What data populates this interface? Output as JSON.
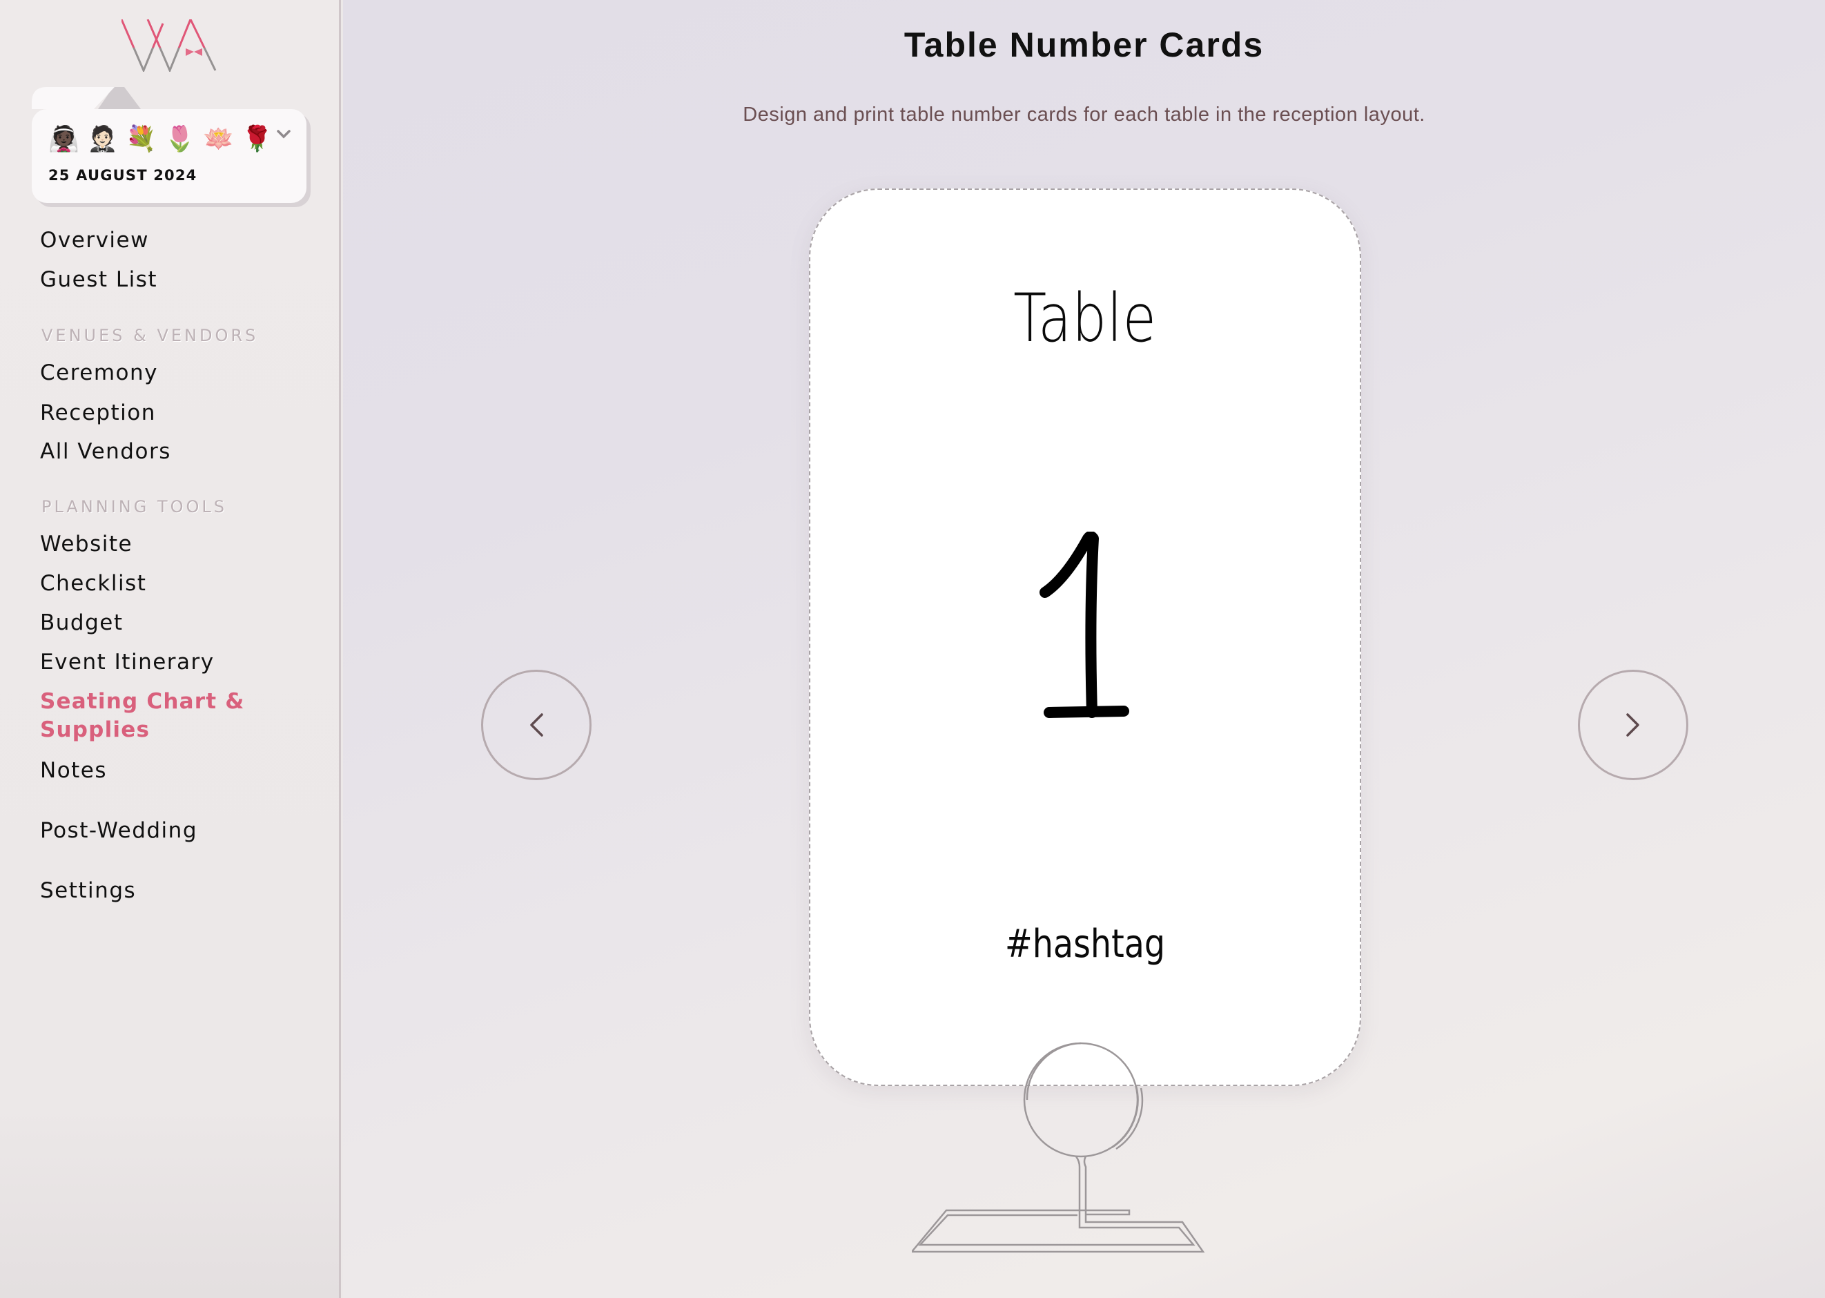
{
  "app": {
    "logo_text": "WA",
    "brand_color": "#d9607c"
  },
  "wedding_card": {
    "emojis": [
      {
        "name": "bride-icon",
        "glyph": "👰🏿"
      },
      {
        "name": "groom-icon",
        "glyph": "🤵🏻"
      },
      {
        "name": "bouquet-icon",
        "glyph": "💐"
      },
      {
        "name": "tulip-icon",
        "glyph": "🌷"
      },
      {
        "name": "lotus-icon",
        "glyph": "🪷"
      },
      {
        "name": "rose-icon",
        "glyph": "🌹"
      }
    ],
    "date": "25 AUGUST 2024"
  },
  "sidebar": {
    "items": [
      {
        "label": "Overview"
      },
      {
        "label": "Guest List"
      }
    ],
    "sections": [
      {
        "heading": "VENUES & VENDORS",
        "items": [
          {
            "label": "Ceremony"
          },
          {
            "label": "Reception"
          },
          {
            "label": "All Vendors"
          }
        ]
      },
      {
        "heading": "PLANNING TOOLS",
        "items": [
          {
            "label": "Website"
          },
          {
            "label": "Checklist"
          },
          {
            "label": "Budget"
          },
          {
            "label": "Event Itinerary"
          },
          {
            "label": "Seating Chart & Supplies",
            "active": true
          },
          {
            "label": "Notes"
          }
        ]
      }
    ],
    "footer_items": [
      {
        "label": "Post-Wedding"
      },
      {
        "label": "Settings"
      }
    ]
  },
  "main": {
    "title": "Table Number Cards",
    "subtitle": "Design and print table number cards for each table in the reception layout.",
    "card": {
      "heading": "Table",
      "number": "1",
      "hashtag": "#hashtag"
    },
    "prev_label": "Previous card",
    "next_label": "Next card"
  }
}
